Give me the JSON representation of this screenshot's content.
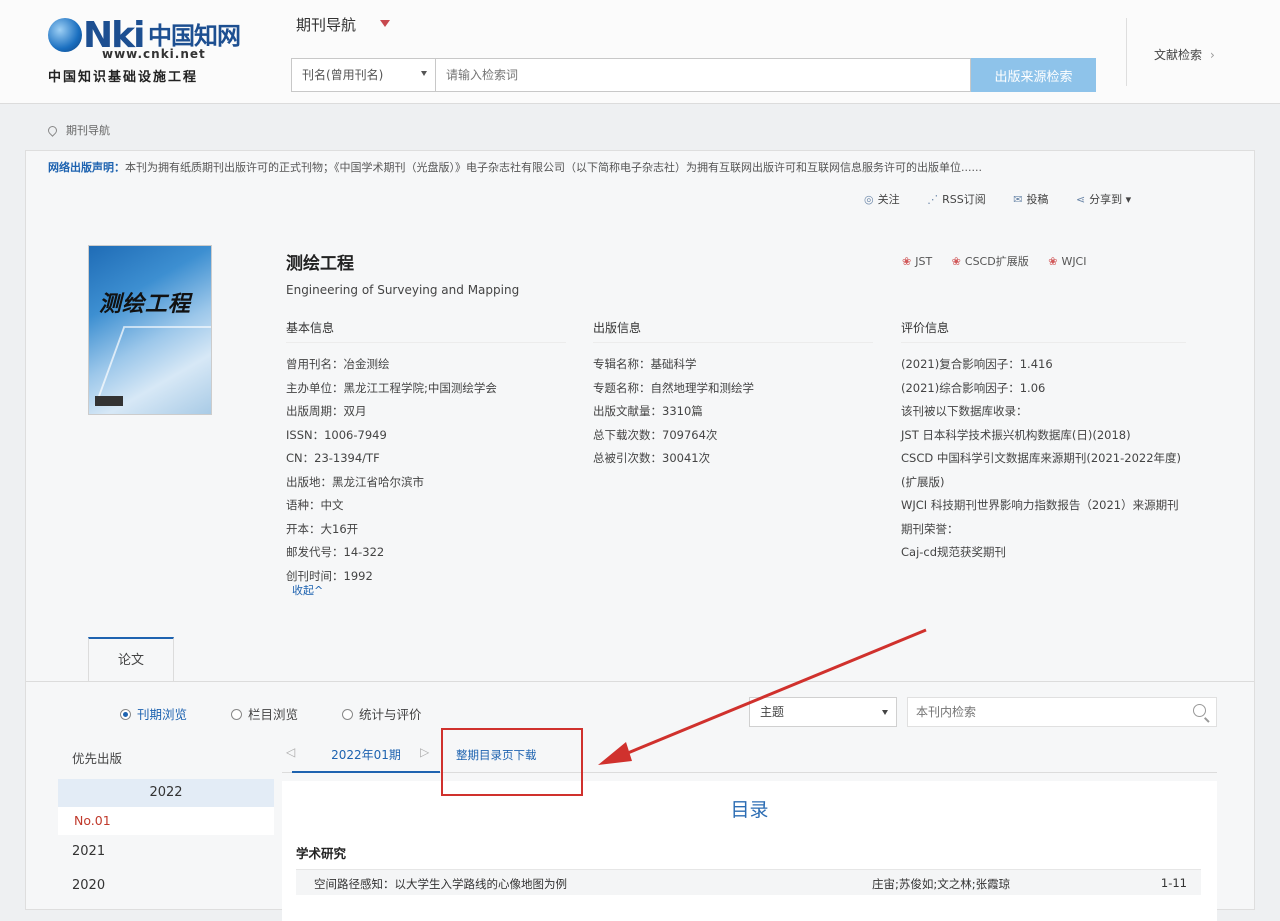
{
  "header": {
    "logo": {
      "mark": "Nki",
      "cn": "中国知网",
      "url": "www.cnki.net",
      "subtitle": "中国知识基础设施工程"
    },
    "nav_title": "期刊导航",
    "search": {
      "type_value": "刊名(曾用刊名)",
      "placeholder": "请输入检索词",
      "button_label": "出版来源检索"
    },
    "doc_search_link": "文献检索",
    "doc_search_arrow": "›"
  },
  "breadcrumb": "期刊导航",
  "notice": {
    "label": "网络出版声明：",
    "text": "本刊为拥有纸质期刊出版许可的正式刊物；《中国学术期刊（光盘版）》电子杂志社有限公司（以下简称电子杂志社）为拥有互联网出版许可和互联网信息服务许可的出版单位......"
  },
  "actions": [
    {
      "icon": "eye-icon",
      "glyph": "◎",
      "label": "关注"
    },
    {
      "icon": "rss-icon",
      "glyph": "⋰",
      "label": "RSS订阅"
    },
    {
      "icon": "mail-icon",
      "glyph": "✉",
      "label": "投稿"
    },
    {
      "icon": "share-icon",
      "glyph": "⋖",
      "label": "分享到 ▾"
    }
  ],
  "journal": {
    "cover_title": "测绘工程",
    "title": "测绘工程",
    "english_title": "Engineering of Surveying and Mapping"
  },
  "badges": [
    "JST",
    "CSCD扩展版",
    "WJCI"
  ],
  "basic_info": {
    "heading": "基本信息",
    "rows": [
      "曾用刊名：冶金测绘",
      "主办单位：黑龙江工程学院;中国测绘学会",
      "出版周期：双月",
      "ISSN：1006-7949",
      "CN：23-1394/TF",
      "出版地：黑龙江省哈尔滨市",
      "语种：中文",
      "开本：大16开",
      "邮发代号：14-322",
      "创刊时间：1992"
    ],
    "collapse": "收起^"
  },
  "publish_info": {
    "heading": "出版信息",
    "rows": [
      "专辑名称：基础科学",
      "专题名称：自然地理学和测绘学",
      "出版文献量：3310篇",
      "总下载次数：709764次",
      "总被引次数：30041次"
    ]
  },
  "eval_info": {
    "heading": "评价信息",
    "rows": [
      "(2021)复合影响因子：1.416",
      "(2021)综合影响因子：1.06",
      "该刊被以下数据库收录：",
      "JST 日本科学技术振兴机构数据库(日)(2018)",
      "CSCD 中国科学引文数据库来源期刊(2021-2022年度)(扩展版)",
      "WJCI 科技期刊世界影响力指数报告（2021）来源期刊",
      "期刊荣誉：",
      "Caj-cd规范获奖期刊"
    ]
  },
  "tabs": {
    "paper": "论文"
  },
  "browse_modes": [
    {
      "label": "刊期浏览",
      "selected": true
    },
    {
      "label": "栏目浏览",
      "selected": false
    },
    {
      "label": "统计与评价",
      "selected": false
    }
  ],
  "topic_select": "主题",
  "in_search_placeholder": "本刊内检索",
  "years": {
    "priority": "优先出版",
    "active_year": "2022",
    "active_issue": "No.01",
    "others": [
      "2021",
      "2020"
    ]
  },
  "issue_tabs": {
    "prev": "◁",
    "current": "2022年01期",
    "next": "▷",
    "toc_download": "整期目录页下载"
  },
  "toc": {
    "title": "目录",
    "section": "学术研究",
    "article": {
      "title": "空间路径感知：以大学生入学路线的心像地图为例",
      "authors": "庄宙;苏俊如;文之林;张霞琼",
      "pages": "1-11"
    }
  },
  "colors": {
    "accent": "#1e63b0",
    "search_button": "#8ec3ea",
    "highlight": "#d0312d",
    "issue_red": "#c0392b"
  }
}
